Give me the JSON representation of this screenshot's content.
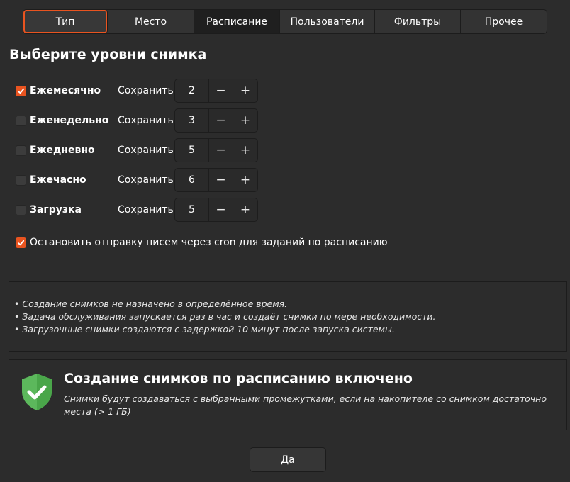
{
  "tabs": [
    {
      "label": "Тип"
    },
    {
      "label": "Место"
    },
    {
      "label": "Расписание"
    },
    {
      "label": "Пользователи"
    },
    {
      "label": "Фильтры"
    },
    {
      "label": "Прочее"
    }
  ],
  "heading": "Выберите уровни снимка",
  "levels": [
    {
      "label": "Ежемесячно",
      "checked": true,
      "keep_label": "Сохранить",
      "value": "2"
    },
    {
      "label": "Еженедельно",
      "checked": false,
      "keep_label": "Сохранить",
      "value": "3"
    },
    {
      "label": "Ежедневно",
      "checked": false,
      "keep_label": "Сохранить",
      "value": "5"
    },
    {
      "label": "Ежечасно",
      "checked": false,
      "keep_label": "Сохранить",
      "value": "6"
    },
    {
      "label": "Загрузка",
      "checked": false,
      "keep_label": "Сохранить",
      "value": "5"
    }
  ],
  "spin": {
    "minus": "−",
    "plus": "+"
  },
  "cron": {
    "label": "Остановить отправку писем через cron для заданий по расписанию",
    "checked": true
  },
  "info": [
    "• Создание снимков не назначено в определённое время.",
    "• Задача обслуживания запускается раз в час и создаёт снимки по мере необходимости.",
    "• Загрузочные снимки создаются с задержкой 10 минут после запуска системы."
  ],
  "status": {
    "title": "Создание снимков по расписанию включено",
    "description": "Снимки будут создаваться с выбранными промежутками, если на накопителе со снимком достаточно места (> 1 ГБ)",
    "icon": "shield-check-icon",
    "icon_color": "#5cb85c"
  },
  "ok_button": "Да",
  "colors": {
    "accent": "#e95420",
    "background": "#2c2c2c"
  }
}
